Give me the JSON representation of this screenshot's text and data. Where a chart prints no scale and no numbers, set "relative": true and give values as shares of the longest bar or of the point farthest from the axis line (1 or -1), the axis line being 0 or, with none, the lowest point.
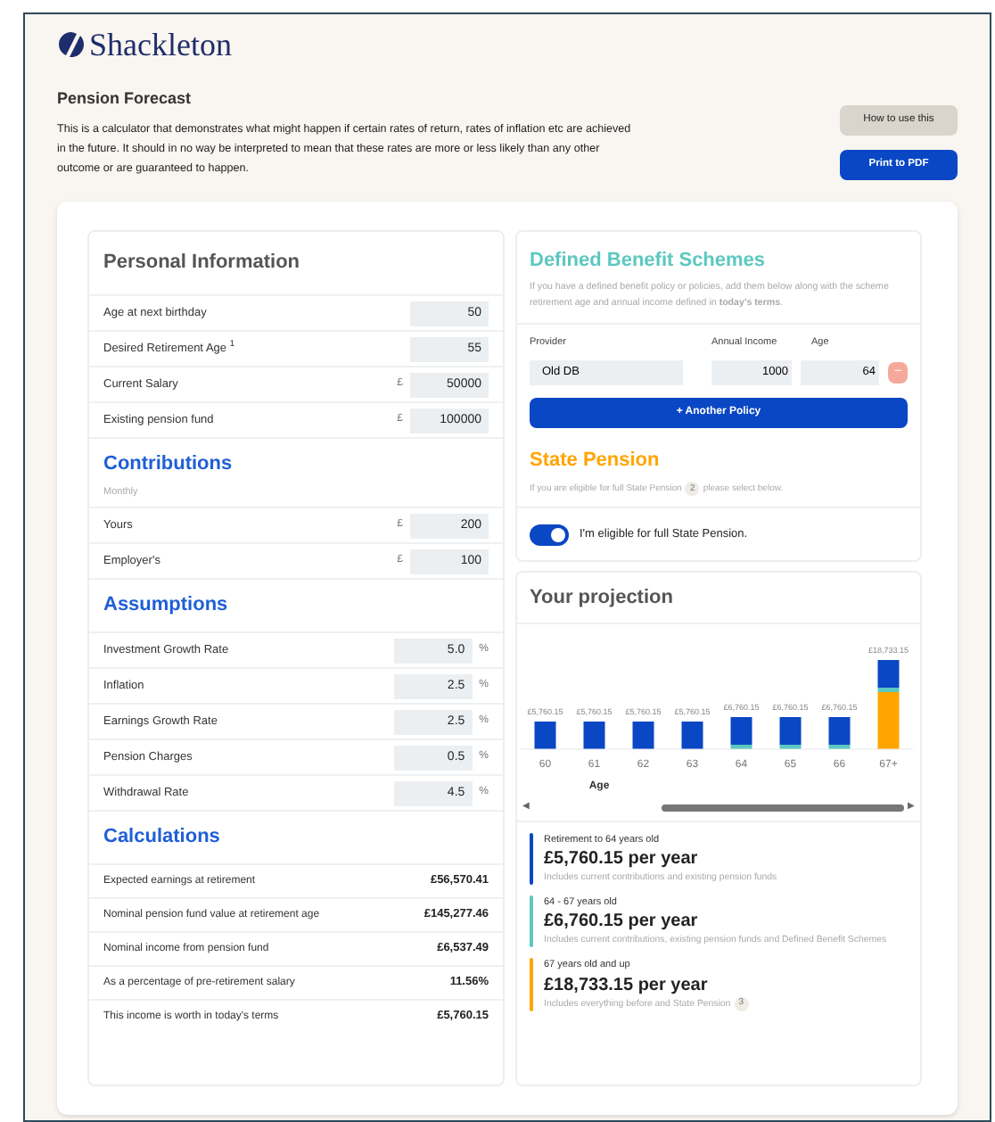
{
  "brand": {
    "name": "Shackleton"
  },
  "header": {
    "title": "Pension Forecast",
    "description": "This is a calculator that demonstrates what might happen if certain rates of return, rates of inflation etc are achieved in the future. It should in no way be interpreted to mean that these rates are more or less likely than any other outcome or are guaranteed to happen.",
    "buttons": [
      {
        "label": "How to use this",
        "kind": "secondary"
      },
      {
        "label": "Print to PDF",
        "kind": "primary"
      }
    ]
  },
  "personal_information": {
    "title": "Personal Information",
    "fields": [
      {
        "label": "Age at next birthday",
        "value": "50"
      },
      {
        "label": "Desired Retirement Age $^{1}$",
        "value": "55"
      },
      {
        "label": "Current Salary",
        "prefix": "£",
        "value": "50000"
      },
      {
        "label": "Existing pension fund",
        "prefix": "£",
        "value": "100000"
      }
    ]
  },
  "contributions": {
    "title": "Contributions",
    "subtitle": "Monthly",
    "fields": [
      {
        "label": "Yours",
        "prefix": "£",
        "value": "200"
      },
      {
        "label": "Employer's",
        "prefix": "£",
        "value": "100"
      }
    ]
  },
  "assumptions": {
    "title": "Assumptions",
    "fields": [
      {
        "label": "Investment Growth Rate",
        "value": "5.0",
        "suffix": "%"
      },
      {
        "label": "Inflation",
        "value": "2.5",
        "suffix": "%"
      },
      {
        "label": "Earnings Growth Rate",
        "value": "2.5",
        "suffix": "%"
      },
      {
        "label": "Pension Charges",
        "value": "0.5",
        "suffix": "%"
      },
      {
        "label": "Withdrawal Rate",
        "value": "4.5",
        "suffix": "%"
      }
    ]
  },
  "calculations": {
    "title": "Calculations",
    "rows": [
      {
        "label": "Expected earnings at retirement",
        "value": "£56,570.41"
      },
      {
        "label": "Nominal pension fund value at retirement age",
        "value": "£145,277.46"
      },
      {
        "label": "Nominal income from pension fund",
        "value": "£6,537.49"
      },
      {
        "label": "As a percentage of pre-retirement salary",
        "value": "11.56%"
      },
      {
        "label": "This income is worth in today's terms",
        "value": "£5,760.15"
      }
    ]
  },
  "defined_benefit": {
    "title": "Defined Benefit Schemes",
    "description": "If you have a defined benefit policy or policies, add them below along with the scheme retirement age and annual income defined in **today's terms**.",
    "columns": [
      "Provider",
      "Annual Income",
      "Age"
    ],
    "policies": [
      {
        "provider": "Old DB",
        "annual_income": "1000",
        "age": "64",
        "remove_label": "−"
      }
    ],
    "add_button": "+ Another Policy"
  },
  "state_pension": {
    "title": "State Pension",
    "description_before": "If you are eligible for full State Pension",
    "note": "2",
    "description_after": "please select below.",
    "toggle_label": "I'm eligible for full State Pension.",
    "eligible": true
  },
  "projection": {
    "title": "Your projection",
    "chart_data": {
      "type": "bar",
      "stacked": true,
      "relative": true,
      "xlabel": "Age",
      "categories": [
        "60",
        "61",
        "62",
        "63",
        "64",
        "65",
        "66",
        "67+"
      ],
      "series": [
        {
          "color": "#0a47c4",
          "values": [
            0.31,
            0.31,
            0.31,
            0.31,
            0.31,
            0.31,
            0.31,
            0.31
          ]
        },
        {
          "color": "#5cc8c0",
          "values": [
            null,
            null,
            null,
            null,
            0.05,
            0.05,
            0.05,
            0.05
          ]
        },
        {
          "color": "#ffa500",
          "values": [
            null,
            null,
            null,
            null,
            null,
            null,
            null,
            0.64
          ]
        }
      ],
      "value_labels": [
        "£5,760.15",
        "£5,760.15",
        "£5,760.15",
        "£5,760.15",
        "£6,760.15",
        "£6,760.15",
        "£6,760.15",
        "£18,733.15"
      ]
    },
    "scroll_left": "◀",
    "scroll_right": "▶",
    "summaries": [
      {
        "heading": "Retirement to 64 years old",
        "amount": "£5,760.15 per year",
        "detail": "Includes current contributions and existing pension funds",
        "color": "#0a47c4"
      },
      {
        "heading": "64 - 67 years old",
        "amount": "£6,760.15 per year",
        "detail": "Includes current contributions, existing pension funds and Defined Benefit Schemes",
        "color": "#5cc8c0"
      },
      {
        "heading": "67 years old and up",
        "amount": "£18,733.15 per year",
        "detail": "Includes everything before and State Pension",
        "note": "3",
        "color": "#ffa500"
      }
    ]
  }
}
